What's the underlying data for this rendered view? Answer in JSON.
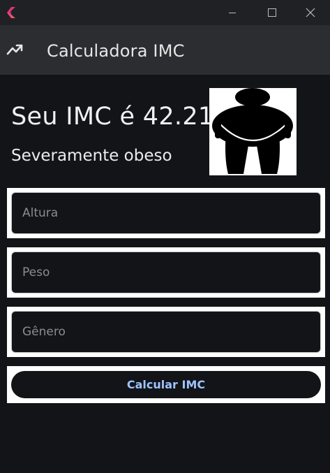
{
  "window": {
    "minimize_icon": "minimize-icon",
    "maximize_icon": "maximize-icon",
    "close_icon": "close-icon"
  },
  "appbar": {
    "icon": "trending-up-icon",
    "title": "Calculadora IMC"
  },
  "result": {
    "title": "Seu IMC é 42.21",
    "classification": "Severamente obeso",
    "figure_icon": "obese-person-icon"
  },
  "form": {
    "height_placeholder": "Altura",
    "weight_placeholder": "Peso",
    "gender_placeholder": "Gênero",
    "submit_label": "Calcular IMC"
  },
  "colors": {
    "background": "#121418",
    "appbar": "#2b2d31",
    "titlebar": "#202124",
    "button_text": "#9fc3ff"
  }
}
